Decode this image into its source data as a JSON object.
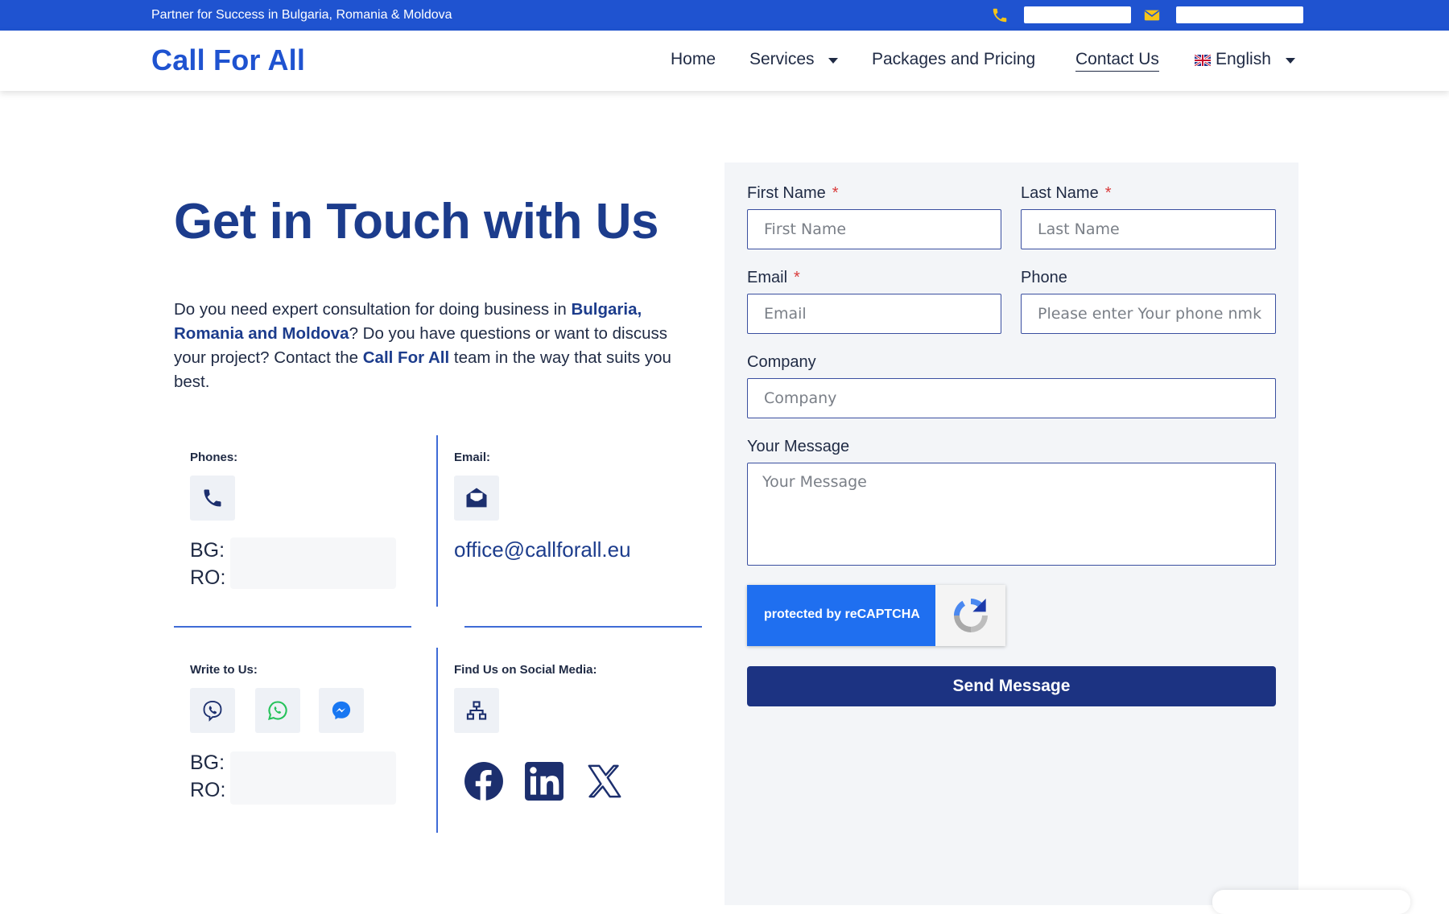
{
  "topbar": {
    "tagline": "Partner for Success in Bulgaria, Romania & Moldova",
    "phone_icon": "phone-icon",
    "email_icon": "envelope-icon",
    "accent_color": "#f5c518",
    "bg_color": "#1f53d0"
  },
  "header": {
    "logo": "Call For All",
    "nav": {
      "home": "Home",
      "services": "Services",
      "packages": "Packages and Pricing",
      "contact": "Contact Us",
      "language": "English"
    }
  },
  "hero": {
    "title": "Get in Touch with Us",
    "intro_part1": "Do you need expert consultation for doing business in ",
    "intro_bold1": "Bulgaria, Romania and Moldova",
    "intro_part2": "? Do you have questions or want to discuss your project? Contact the ",
    "intro_bold2": "Call For All",
    "intro_part3": " team in the way that suits you best."
  },
  "contact": {
    "phones_label": "Phones:",
    "email_label": "Email:",
    "email_value": "office@callforall.eu",
    "write_label": "Write to Us:",
    "social_label": "Find Us on Social Media:",
    "bg_prefix": "BG:",
    "ro_prefix": "RO:"
  },
  "form": {
    "first_name_label": "First Name",
    "first_name_placeholder": "First Name",
    "last_name_label": "Last Name",
    "last_name_placeholder": "Last Name",
    "email_label": "Email",
    "email_placeholder": "Email",
    "phone_label": "Phone",
    "phone_placeholder": "Please enter Your phone nmk",
    "company_label": "Company",
    "company_placeholder": "Company",
    "message_label": "Your Message",
    "message_placeholder": "Your Message",
    "required_mark": "*",
    "recaptcha_text": "protected by reCAPTCHA",
    "submit_label": "Send Message"
  }
}
